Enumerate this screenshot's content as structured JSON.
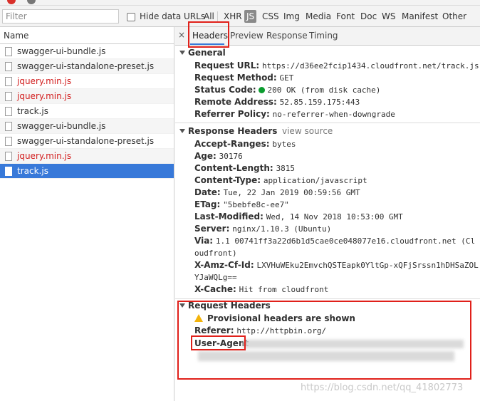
{
  "filter": {
    "placeholder": "Filter"
  },
  "filterbar": {
    "hide_data_urls": "Hide data URLs",
    "types": [
      "All",
      "XHR",
      "JS",
      "CSS",
      "Img",
      "Media",
      "Font",
      "Doc",
      "WS",
      "Manifest",
      "Other"
    ],
    "active_type": "JS"
  },
  "left": {
    "header": "Name",
    "files": [
      {
        "name": "swagger-ui-bundle.js",
        "style": "normal"
      },
      {
        "name": "swagger-ui-standalone-preset.js",
        "style": "normal"
      },
      {
        "name": "jquery.min.js",
        "style": "red"
      },
      {
        "name": "jquery.min.js",
        "style": "red"
      },
      {
        "name": "track.js",
        "style": "normal"
      },
      {
        "name": "swagger-ui-bundle.js",
        "style": "normal"
      },
      {
        "name": "swagger-ui-standalone-preset.js",
        "style": "normal"
      },
      {
        "name": "jquery.min.js",
        "style": "red"
      },
      {
        "name": "track.js",
        "style": "selected"
      }
    ]
  },
  "tabs": {
    "close": "×",
    "headers": "Headers",
    "preview": "Preview",
    "response": "Response",
    "timing": "Timing"
  },
  "general": {
    "title": "General",
    "request_url_k": "Request URL:",
    "request_url_v": "https://d36ee2fcip1434.cloudfront.net/track.js",
    "method_k": "Request Method:",
    "method_v": "GET",
    "status_k": "Status Code:",
    "status_v": "200 OK (from disk cache)",
    "remote_k": "Remote Address:",
    "remote_v": "52.85.159.175:443",
    "referrer_k": "Referrer Policy:",
    "referrer_v": "no-referrer-when-downgrade"
  },
  "response_headers": {
    "title": "Response Headers",
    "view_source": "view source",
    "rows": [
      {
        "k": "Accept-Ranges:",
        "v": "bytes"
      },
      {
        "k": "Age:",
        "v": "30176"
      },
      {
        "k": "Content-Length:",
        "v": "3815"
      },
      {
        "k": "Content-Type:",
        "v": "application/javascript"
      },
      {
        "k": "Date:",
        "v": "Tue, 22 Jan 2019 00:59:56 GMT"
      },
      {
        "k": "ETag:",
        "v": "\"5bebfe8c-ee7\""
      },
      {
        "k": "Last-Modified:",
        "v": "Wed, 14 Nov 2018 10:53:00 GMT"
      },
      {
        "k": "Server:",
        "v": "nginx/1.10.3 (Ubuntu)"
      },
      {
        "k": "Via:",
        "v": "1.1 00741ff3a22d6b1d5cae0ce048077e16.cloudfront.net (Cloudfront)"
      },
      {
        "k": "X-Amz-Cf-Id:",
        "v": "LXVHuWEku2EmvchQSTEapk0YltGp-xQFjSrssn1hDHSaZOLYJaWQLg=="
      },
      {
        "k": "X-Cache:",
        "v": "Hit from cloudfront"
      }
    ]
  },
  "request_headers": {
    "title": "Request Headers",
    "provisional": "Provisional headers are shown",
    "referer_k": "Referer:",
    "referer_v": "http://httpbin.org/",
    "ua_k": "User-Agent"
  },
  "watermark": "https://blog.csdn.net/qq_41802773"
}
